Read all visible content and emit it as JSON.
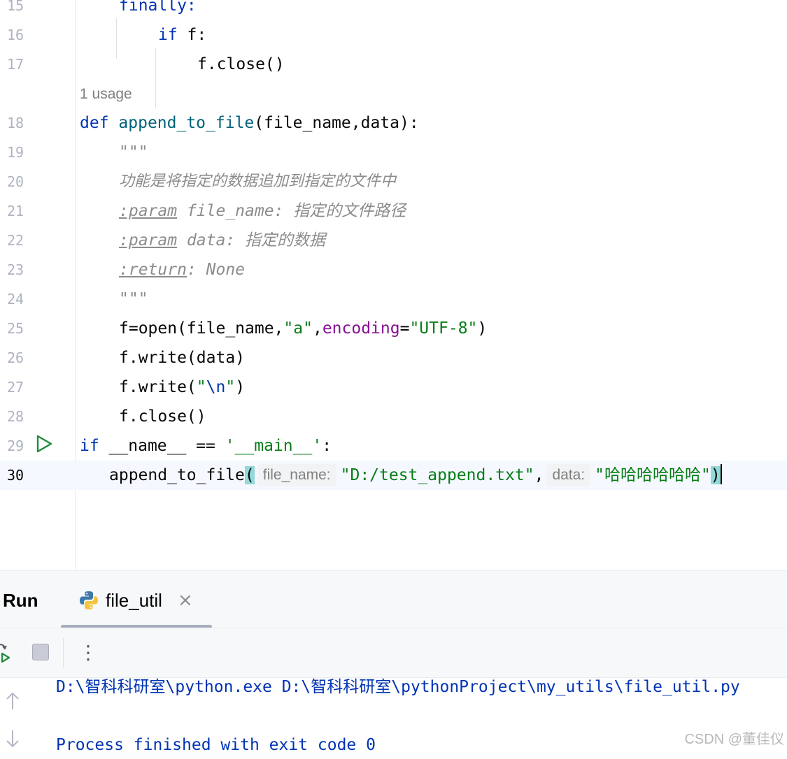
{
  "editor": {
    "usage_hint": "1 usage",
    "line_numbers": [
      "15",
      "16",
      "17",
      "18",
      "19",
      "20",
      "21",
      "22",
      "23",
      "24",
      "25",
      "26",
      "27",
      "28",
      "29",
      "30"
    ],
    "code": {
      "l15": "finally:",
      "l16_kw": "if",
      "l16_rest": " f:",
      "l17": "f.close()",
      "l18_kw": "def",
      "l18_fn": "append_to_file",
      "l18_rest": "(file_name,data):",
      "l19": "\"\"\"",
      "l20": "功能是将指定的数据追加到指定的文件中",
      "l21_tag": ":param",
      "l21_rest": " file_name: 指定的文件路径",
      "l22_tag": ":param",
      "l22_rest": " data: 指定的数据",
      "l23_tag": ":return",
      "l23_rest": ": None",
      "l24": "\"\"\"",
      "l25_a": "f=open(file_name,",
      "l25_str1": "\"a\"",
      "l25_comma": ",",
      "l25_kwarg": "encoding",
      "l25_eq": "=",
      "l25_str2": "\"UTF-8\"",
      "l25_close": ")",
      "l26": "f.write(data)",
      "l27_a": "f.write(",
      "l27_q1": "\"",
      "l27_esc": "\\n",
      "l27_q2": "\"",
      "l27_close": ")",
      "l28": "f.close()",
      "l29_kw": "if",
      "l29_mid": " __name__ == ",
      "l29_str": "'__main__'",
      "l29_end": ":",
      "l30_fn": "append_to_file",
      "l30_open": "(",
      "l30_hint1": "file_name:",
      "l30_str1": "\"D:/test_append.txt\"",
      "l30_comma": ",",
      "l30_hint2": "data:",
      "l30_str2": "\"哈哈哈哈哈哈\"",
      "l30_close": ")"
    }
  },
  "run_panel": {
    "title": "Run",
    "tab_label": "file_util",
    "tab_close": "×",
    "more_menu": "⋮",
    "console": [
      "D:\\智科科研室\\python.exe D:\\智科科研室\\pythonProject\\my_utils\\file_util.py",
      "Process finished with exit code 0"
    ]
  },
  "watermark": "CSDN @董佳仪",
  "colors": {
    "keyword": "#0033b3",
    "function": "#00627a",
    "string": "#067d17",
    "kwarg": "#871094",
    "docstring": "#8c8c8c",
    "current_line": "#f5f8fe",
    "brace_highlight": "#93d9d9"
  },
  "icons": {
    "gutter_run": "run-triangle-icon",
    "tab": "python-file-icon",
    "rerun": "rerun-icon",
    "stop": "stop-icon",
    "scroll_up": "arrow-up-icon",
    "scroll_down": "arrow-down-icon"
  }
}
